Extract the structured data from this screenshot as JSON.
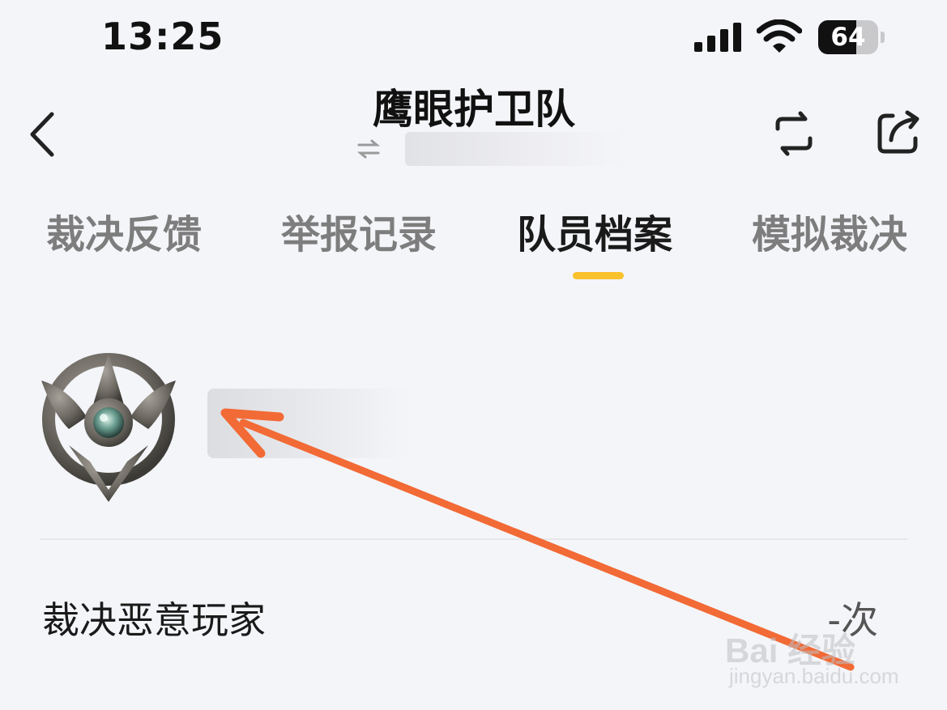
{
  "status_bar": {
    "time": "13:25",
    "battery_level": "64",
    "battery_fraction": 0.64
  },
  "nav": {
    "title": "鹰眼护卫队"
  },
  "tabs": [
    {
      "label": "裁决反馈",
      "active": false
    },
    {
      "label": "举报记录",
      "active": false
    },
    {
      "label": "队员档案",
      "active": true
    },
    {
      "label": "模拟裁决",
      "active": false
    }
  ],
  "colors": {
    "accent": "#f9c12c",
    "annotation_arrow": "#f26a35",
    "background": "#f4f5f9"
  },
  "stats": {
    "label": "裁决恶意玩家",
    "value": "-次"
  },
  "watermark": {
    "brand": "Bai 经验",
    "url": "jingyan.baidu.com"
  }
}
